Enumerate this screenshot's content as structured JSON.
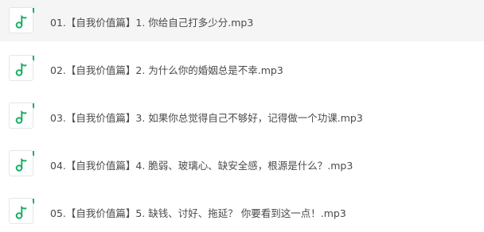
{
  "files": [
    {
      "name": "01.【自我价值篇】1. 你给自己打多少分.mp3",
      "icon": "music-note-icon",
      "selected": true
    },
    {
      "name": "02.【自我价值篇】2. 为什么你的婚姻总是不幸.mp3",
      "icon": "music-note-icon",
      "selected": false
    },
    {
      "name": "03.【自我价值篇】3. 如果你总觉得自己不够好，记得做一个功课.mp3",
      "icon": "music-note-icon",
      "selected": false
    },
    {
      "name": "04.【自我价值篇】4. 脆弱、玻璃心、缺安全感，根源是什么？.mp3",
      "icon": "music-note-icon",
      "selected": false
    },
    {
      "name": "05.【自我价值篇】5. 缺钱、讨好、拖延？ 你要看到这一点！.mp3",
      "icon": "music-note-icon",
      "selected": false
    }
  ],
  "colors": {
    "accent": "#1aae66",
    "selected_row_bg": "#f5f5f6",
    "text": "#4a4a4a"
  }
}
